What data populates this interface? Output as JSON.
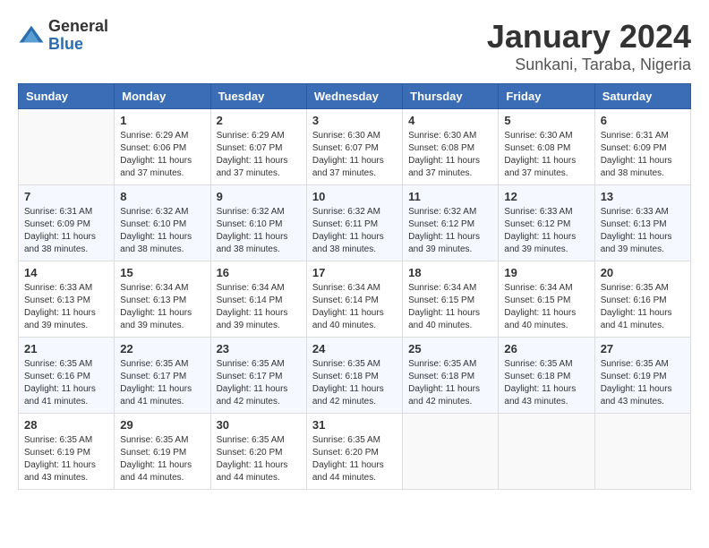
{
  "header": {
    "logo": {
      "general": "General",
      "blue": "Blue"
    },
    "title": "January 2024",
    "subtitle": "Sunkani, Taraba, Nigeria"
  },
  "weekdays": [
    "Sunday",
    "Monday",
    "Tuesday",
    "Wednesday",
    "Thursday",
    "Friday",
    "Saturday"
  ],
  "weeks": [
    [
      {
        "day": null
      },
      {
        "day": 1,
        "sunrise": "6:29 AM",
        "sunset": "6:06 PM",
        "daylight": "11 hours and 37 minutes."
      },
      {
        "day": 2,
        "sunrise": "6:29 AM",
        "sunset": "6:07 PM",
        "daylight": "11 hours and 37 minutes."
      },
      {
        "day": 3,
        "sunrise": "6:30 AM",
        "sunset": "6:07 PM",
        "daylight": "11 hours and 37 minutes."
      },
      {
        "day": 4,
        "sunrise": "6:30 AM",
        "sunset": "6:08 PM",
        "daylight": "11 hours and 37 minutes."
      },
      {
        "day": 5,
        "sunrise": "6:30 AM",
        "sunset": "6:08 PM",
        "daylight": "11 hours and 37 minutes."
      },
      {
        "day": 6,
        "sunrise": "6:31 AM",
        "sunset": "6:09 PM",
        "daylight": "11 hours and 38 minutes."
      }
    ],
    [
      {
        "day": 7,
        "sunrise": "6:31 AM",
        "sunset": "6:09 PM",
        "daylight": "11 hours and 38 minutes."
      },
      {
        "day": 8,
        "sunrise": "6:32 AM",
        "sunset": "6:10 PM",
        "daylight": "11 hours and 38 minutes."
      },
      {
        "day": 9,
        "sunrise": "6:32 AM",
        "sunset": "6:10 PM",
        "daylight": "11 hours and 38 minutes."
      },
      {
        "day": 10,
        "sunrise": "6:32 AM",
        "sunset": "6:11 PM",
        "daylight": "11 hours and 38 minutes."
      },
      {
        "day": 11,
        "sunrise": "6:32 AM",
        "sunset": "6:12 PM",
        "daylight": "11 hours and 39 minutes."
      },
      {
        "day": 12,
        "sunrise": "6:33 AM",
        "sunset": "6:12 PM",
        "daylight": "11 hours and 39 minutes."
      },
      {
        "day": 13,
        "sunrise": "6:33 AM",
        "sunset": "6:13 PM",
        "daylight": "11 hours and 39 minutes."
      }
    ],
    [
      {
        "day": 14,
        "sunrise": "6:33 AM",
        "sunset": "6:13 PM",
        "daylight": "11 hours and 39 minutes."
      },
      {
        "day": 15,
        "sunrise": "6:34 AM",
        "sunset": "6:13 PM",
        "daylight": "11 hours and 39 minutes."
      },
      {
        "day": 16,
        "sunrise": "6:34 AM",
        "sunset": "6:14 PM",
        "daylight": "11 hours and 39 minutes."
      },
      {
        "day": 17,
        "sunrise": "6:34 AM",
        "sunset": "6:14 PM",
        "daylight": "11 hours and 40 minutes."
      },
      {
        "day": 18,
        "sunrise": "6:34 AM",
        "sunset": "6:15 PM",
        "daylight": "11 hours and 40 minutes."
      },
      {
        "day": 19,
        "sunrise": "6:34 AM",
        "sunset": "6:15 PM",
        "daylight": "11 hours and 40 minutes."
      },
      {
        "day": 20,
        "sunrise": "6:35 AM",
        "sunset": "6:16 PM",
        "daylight": "11 hours and 41 minutes."
      }
    ],
    [
      {
        "day": 21,
        "sunrise": "6:35 AM",
        "sunset": "6:16 PM",
        "daylight": "11 hours and 41 minutes."
      },
      {
        "day": 22,
        "sunrise": "6:35 AM",
        "sunset": "6:17 PM",
        "daylight": "11 hours and 41 minutes."
      },
      {
        "day": 23,
        "sunrise": "6:35 AM",
        "sunset": "6:17 PM",
        "daylight": "11 hours and 42 minutes."
      },
      {
        "day": 24,
        "sunrise": "6:35 AM",
        "sunset": "6:18 PM",
        "daylight": "11 hours and 42 minutes."
      },
      {
        "day": 25,
        "sunrise": "6:35 AM",
        "sunset": "6:18 PM",
        "daylight": "11 hours and 42 minutes."
      },
      {
        "day": 26,
        "sunrise": "6:35 AM",
        "sunset": "6:18 PM",
        "daylight": "11 hours and 43 minutes."
      },
      {
        "day": 27,
        "sunrise": "6:35 AM",
        "sunset": "6:19 PM",
        "daylight": "11 hours and 43 minutes."
      }
    ],
    [
      {
        "day": 28,
        "sunrise": "6:35 AM",
        "sunset": "6:19 PM",
        "daylight": "11 hours and 43 minutes."
      },
      {
        "day": 29,
        "sunrise": "6:35 AM",
        "sunset": "6:19 PM",
        "daylight": "11 hours and 44 minutes."
      },
      {
        "day": 30,
        "sunrise": "6:35 AM",
        "sunset": "6:20 PM",
        "daylight": "11 hours and 44 minutes."
      },
      {
        "day": 31,
        "sunrise": "6:35 AM",
        "sunset": "6:20 PM",
        "daylight": "11 hours and 44 minutes."
      },
      {
        "day": null
      },
      {
        "day": null
      },
      {
        "day": null
      }
    ]
  ]
}
